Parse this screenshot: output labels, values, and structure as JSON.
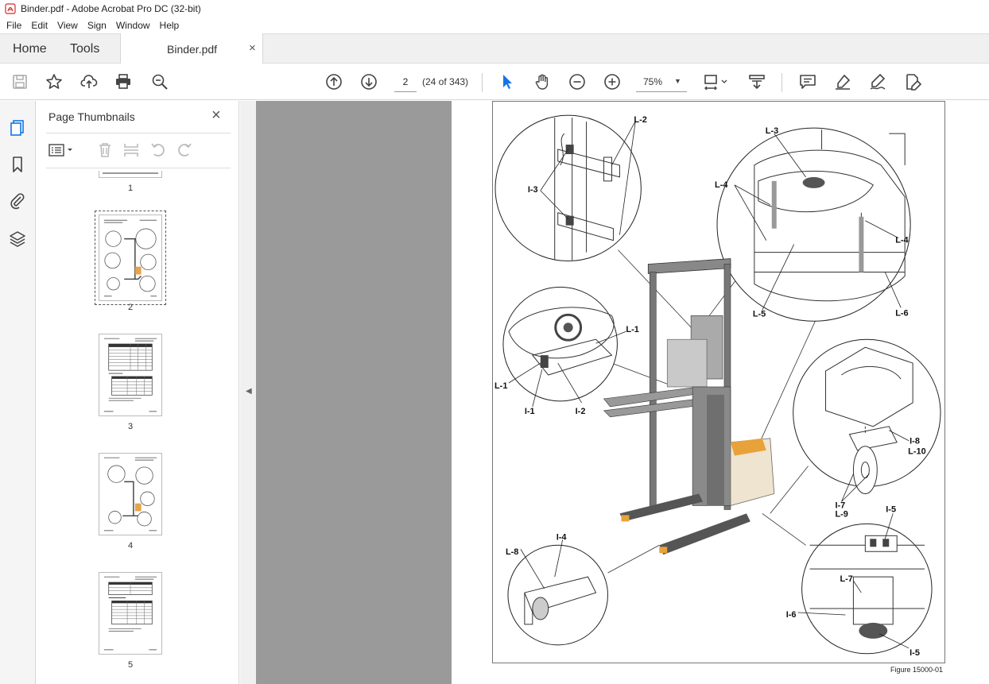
{
  "window": {
    "title": "Binder.pdf - Adobe Acrobat Pro DC (32-bit)"
  },
  "menu": [
    "File",
    "Edit",
    "View",
    "Sign",
    "Window",
    "Help"
  ],
  "tabs": {
    "home": "Home",
    "tools": "Tools",
    "document": "Binder.pdf",
    "close_glyph": "×"
  },
  "toolbar": {
    "page_number": "2",
    "page_count": "(24 of 343)",
    "zoom": "75%",
    "icons": [
      "save-icon",
      "star-icon",
      "upload-icon",
      "print-icon",
      "find-zoom-icon",
      "prev-page-icon",
      "next-page-icon",
      "select-arrow-icon",
      "hand-icon",
      "zoom-out-icon",
      "zoom-in-icon",
      "fit-page-icon",
      "scroll-mode-icon",
      "comment-icon",
      "highlight-icon",
      "sign-icon",
      "edit-pdf-icon"
    ],
    "accent_color": "#1473e6"
  },
  "panel": {
    "title": "Page Thumbnails",
    "close_glyph": "×",
    "thumbnails": [
      {
        "label": "1"
      },
      {
        "label": "2"
      },
      {
        "label": "3"
      },
      {
        "label": "4"
      },
      {
        "label": "5"
      }
    ]
  },
  "figure": {
    "labels": {
      "l2": "L-2",
      "i3": "I-3",
      "l3": "L-3",
      "l4a": "L-4",
      "l4b": "L-4",
      "l5": "L-5",
      "l6": "L-6",
      "l1a": "L-1",
      "l1b": "L-1",
      "i1": "I-1",
      "i2": "I-2",
      "i8": "I-8",
      "l10": "L-10",
      "i7": "I-7",
      "l9": "L-9",
      "i5a": "I-5",
      "l8": "L-8",
      "i4": "I-4",
      "l7": "L-7",
      "i6": "I-6",
      "i5b": "I-5"
    },
    "caption": "Figure 15000-01"
  }
}
